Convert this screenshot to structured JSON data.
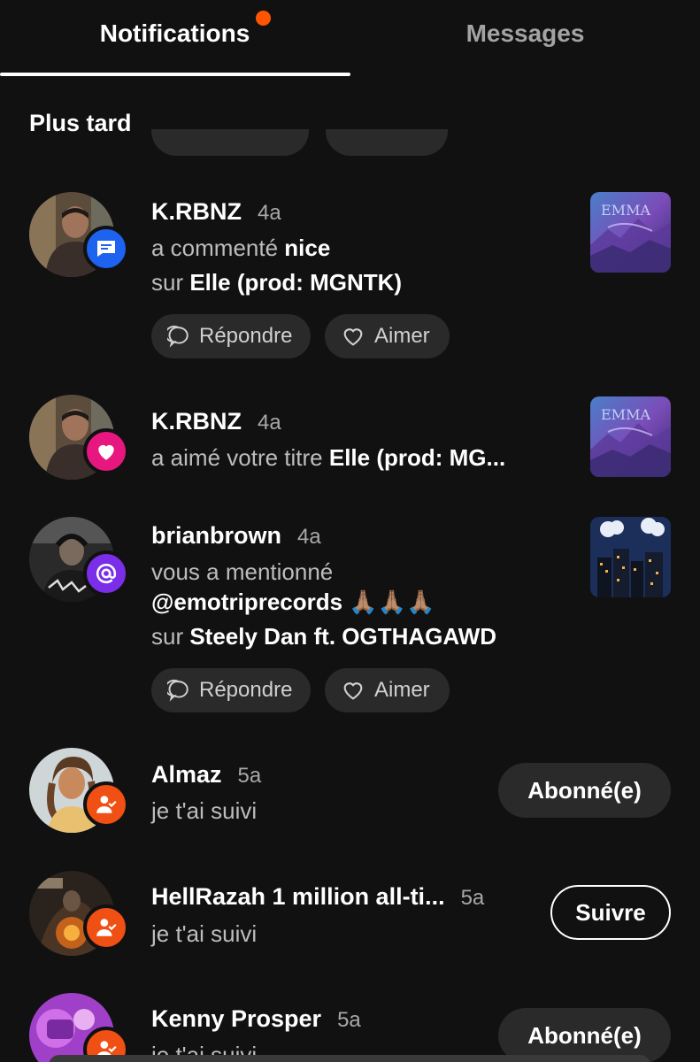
{
  "tabs": {
    "notifications": "Notifications",
    "messages": "Messages"
  },
  "colors": {
    "background": "#111112",
    "accent": "#ff5500",
    "comment_badge": "#1e62f0",
    "like_badge": "#e8177f",
    "mention_badge": "#7a2ee8",
    "follow_badge": "#f05014"
  },
  "section": {
    "title": "Plus tard"
  },
  "actions": {
    "reply": "Répondre",
    "like": "Aimer"
  },
  "notifications": [
    {
      "user": "K.RBNZ",
      "time": "4a",
      "icon": "comment-icon",
      "line1_prefix": "a commenté ",
      "line1_bold": "nice",
      "line2_prefix": "sur ",
      "line2_bold": "Elle (prod: MGNTK)"
    },
    {
      "user": "K.RBNZ",
      "time": "4a",
      "icon": "heart-icon",
      "line1_prefix": "a aimé votre titre ",
      "line1_bold": "Elle (prod: MG..."
    },
    {
      "user": "brianbrown",
      "time": "4a",
      "icon": "at-icon",
      "line1": "vous a mentionné",
      "line2_bold": "@emotriprecords",
      "emoji": "🙏🏽🙏🏽🙏🏽",
      "line3_prefix": "sur ",
      "line3_bold": "Steely Dan ft. OGTHAGAWD"
    },
    {
      "user": "Almaz",
      "time": "5a",
      "icon": "user-check-icon",
      "text": "je t'ai suivi",
      "button": "Abonné(e)"
    },
    {
      "user": "HellRazah 1 million all-ti...",
      "time": "5a",
      "icon": "user-check-icon",
      "text": "je t'ai suivi",
      "button": "Suivre"
    },
    {
      "user": "Kenny Prosper",
      "time": "5a",
      "icon": "user-check-icon",
      "text": "je t'ai suivi",
      "button": "Abonné(e)"
    }
  ]
}
